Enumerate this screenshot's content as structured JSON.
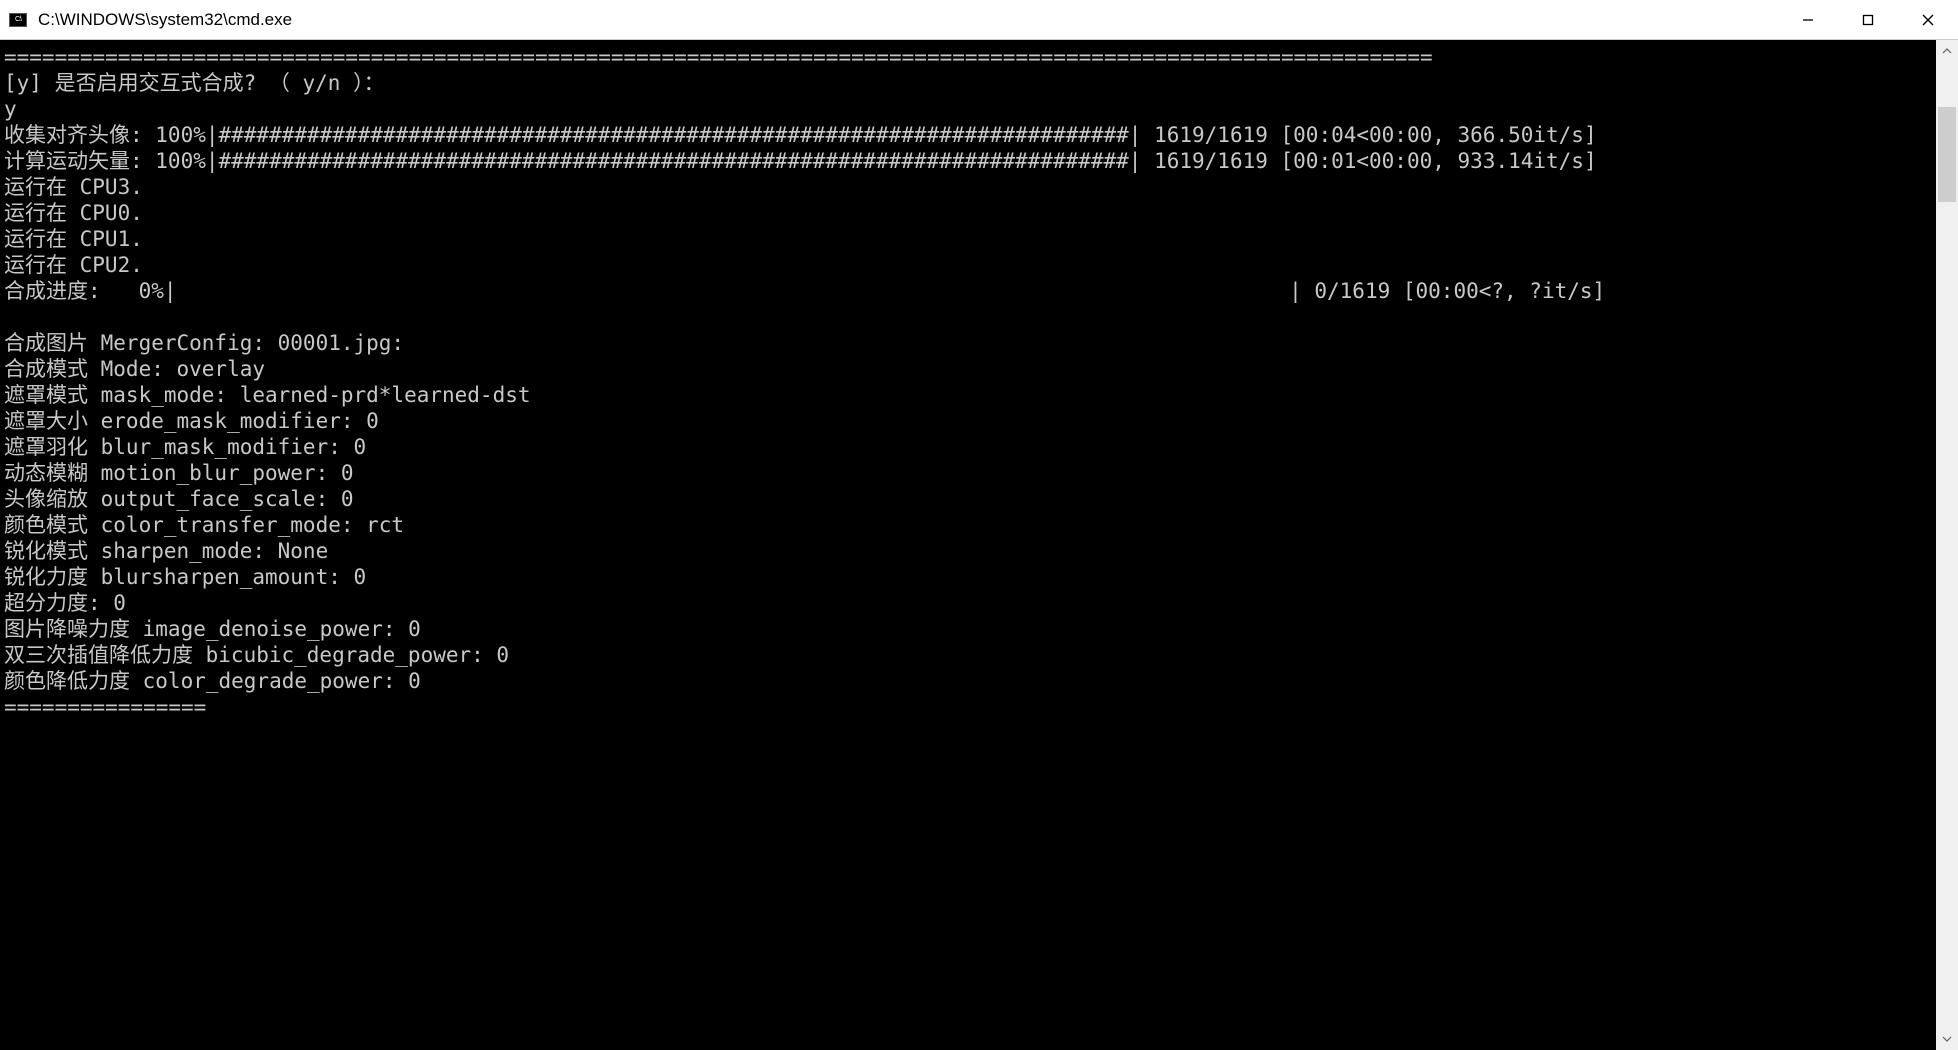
{
  "window": {
    "title": "C:\\WINDOWS\\system32\\cmd.exe"
  },
  "terminal": {
    "divider_top": "=================================================================================================================",
    "prompt_line": "[y] 是否启用交互式合成? （ y/n ）：",
    "prompt_answer": "y",
    "progress1": {
      "label": "收集对齐头像: 100%",
      "bar": "|########################################################################| 1619/1619 [00:04<00:00, 366.50it/s]"
    },
    "progress2": {
      "label": "计算运动矢量: 100%",
      "bar": "|########################################################################| 1619/1619 [00:01<00:00, 933.14it/s]"
    },
    "cpu_lines": {
      "l1": "运行在 CPU3.",
      "l2": "运行在 CPU0.",
      "l3": "运行在 CPU1.",
      "l4": "运行在 CPU2."
    },
    "progress3": {
      "label": "合成进度:   0%",
      "bar": "|                                                                                        | 0/1619 [00:00<?, ?it/s]"
    },
    "blank": "",
    "config": {
      "l1": "合成图片 MergerConfig: 00001.jpg:",
      "l2": "合成模式 Mode: overlay",
      "l3": "遮罩模式 mask_mode: learned-prd*learned-dst",
      "l4": "遮罩大小 erode_mask_modifier: 0",
      "l5": "遮罩羽化 blur_mask_modifier: 0",
      "l6": "动态模糊 motion_blur_power: 0",
      "l7": "头像缩放 output_face_scale: 0",
      "l8": "颜色模式 color_transfer_mode: rct",
      "l9": "锐化模式 sharpen_mode: None",
      "l10": "锐化力度 blursharpen_amount: 0",
      "l11": "超分力度: 0",
      "l12": "图片降噪力度 image_denoise_power: 0",
      "l13": "双三次插值降低力度 bicubic_degrade_power: 0",
      "l14": "颜色降低力度 color_degrade_power: 0"
    },
    "divider_bottom": "================"
  }
}
